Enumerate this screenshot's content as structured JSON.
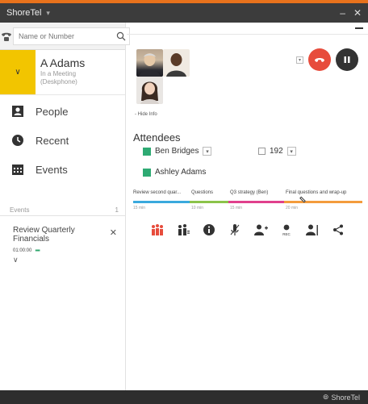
{
  "window": {
    "title": "ShoreTel",
    "minimize_glyph": "–",
    "close_glyph": "✕"
  },
  "search": {
    "placeholder": "Name or Number"
  },
  "user": {
    "name": "A Adams",
    "status_line1": "In a Meeting",
    "status_line2": "(Deskphone)"
  },
  "nav": {
    "items": [
      {
        "label": "People",
        "icon": "person-card-icon"
      },
      {
        "label": "Recent",
        "icon": "clock-icon"
      },
      {
        "label": "Events",
        "icon": "calendar-icon"
      }
    ]
  },
  "events": {
    "header_label": "Events",
    "count": "1",
    "item": {
      "title": "Review Quarterly Financials",
      "time": "01:00:00",
      "close_glyph": "✕"
    }
  },
  "call": {
    "hide_info": "- Hide Info",
    "attendees_title": "Attendees",
    "attendees": [
      {
        "name": "Ben Bridges"
      },
      {
        "name": "Ashley Adams"
      }
    ],
    "dial_extension": "192"
  },
  "agenda": {
    "segments": [
      {
        "label": "Review second quar...",
        "duration": "15 min",
        "color": "#3aa9dd"
      },
      {
        "label": "Questions",
        "duration": "10 min",
        "color": "#8bc34a"
      },
      {
        "label": "Q3 strategy (Ben)",
        "duration": "15 min",
        "color": "#e0408c"
      },
      {
        "label": "Final questions and wrap-up",
        "duration": "20 min",
        "color": "#f39c3c"
      }
    ],
    "progress": 0.74
  },
  "toolbar": {
    "buttons": [
      {
        "name": "participants-icon",
        "color": "#e74c3c"
      },
      {
        "name": "group-manage-icon",
        "color": "#333333"
      },
      {
        "name": "info-icon",
        "color": "#333333"
      },
      {
        "name": "microphone-icon",
        "color": "#333333"
      },
      {
        "name": "add-person-icon",
        "color": "#333333"
      },
      {
        "name": "record-icon",
        "color": "#333333",
        "label": "REC"
      },
      {
        "name": "transfer-person-icon",
        "color": "#333333"
      },
      {
        "name": "share-icon",
        "color": "#333333"
      }
    ]
  },
  "footer": {
    "brand": "ShoreTel"
  },
  "colors": {
    "accent": "#e8721c",
    "status_yellow": "#f2c500",
    "presence_green": "#2eaa73",
    "hangup_red": "#e74c3c"
  }
}
